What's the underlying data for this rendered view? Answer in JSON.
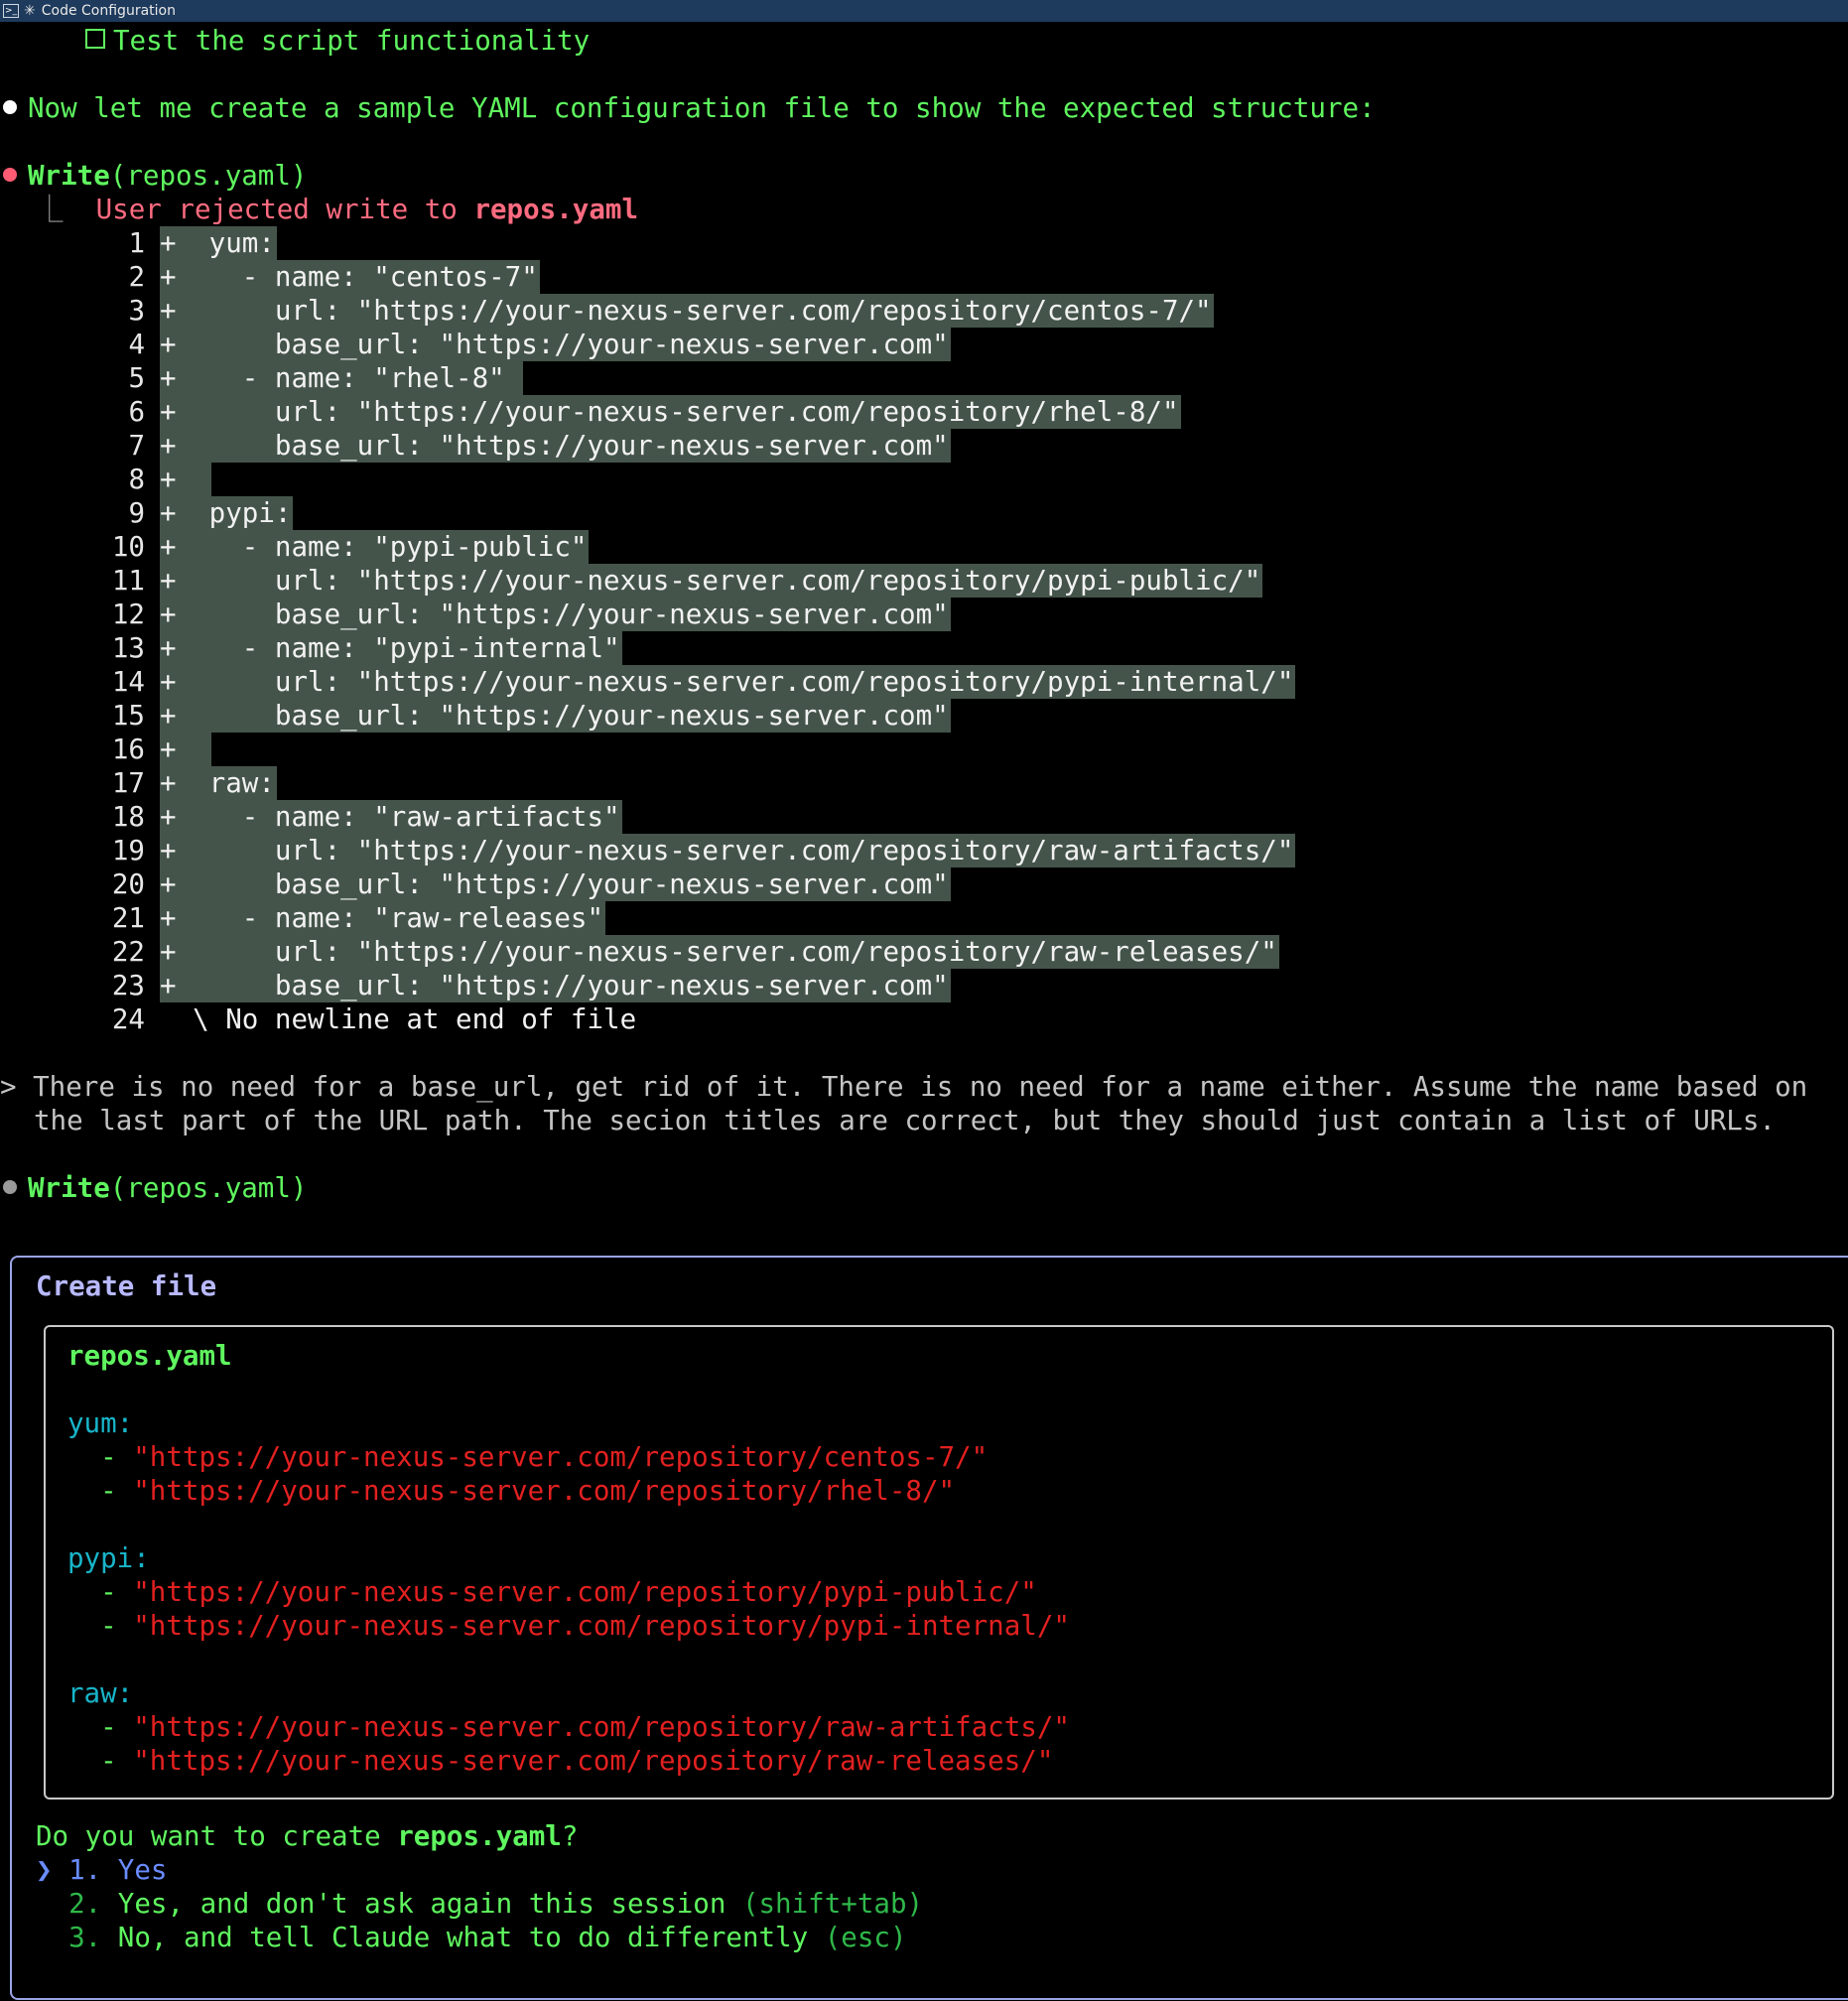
{
  "window": {
    "title": "Code Configuration"
  },
  "top_task": "Test the script functionality",
  "message1": "Now let me create a sample YAML configuration file to show the expected structure:",
  "write1": {
    "tool": "Write",
    "args": "(repos.yaml)",
    "rejected_prefix": "User rejected write to ",
    "rejected_file": "repos.yaml"
  },
  "diff": [
    {
      "n": "1",
      "t": "+  yum:"
    },
    {
      "n": "2",
      "t": "+    - name: \"centos-7\""
    },
    {
      "n": "3",
      "t": "+      url: \"https://your-nexus-server.com/repository/centos-7/\""
    },
    {
      "n": "4",
      "t": "+      base_url: \"https://your-nexus-server.com\""
    },
    {
      "n": "5",
      "t": "+    - name: \"rhel-8\" "
    },
    {
      "n": "6",
      "t": "+      url: \"https://your-nexus-server.com/repository/rhel-8/\""
    },
    {
      "n": "7",
      "t": "+      base_url: \"https://your-nexus-server.com\""
    },
    {
      "n": "8",
      "t": "+  "
    },
    {
      "n": "9",
      "t": "+  pypi:"
    },
    {
      "n": "10",
      "t": "+    - name: \"pypi-public\""
    },
    {
      "n": "11",
      "t": "+      url: \"https://your-nexus-server.com/repository/pypi-public/\""
    },
    {
      "n": "12",
      "t": "+      base_url: \"https://your-nexus-server.com\""
    },
    {
      "n": "13",
      "t": "+    - name: \"pypi-internal\""
    },
    {
      "n": "14",
      "t": "+      url: \"https://your-nexus-server.com/repository/pypi-internal/\""
    },
    {
      "n": "15",
      "t": "+      base_url: \"https://your-nexus-server.com\""
    },
    {
      "n": "16",
      "t": "+  "
    },
    {
      "n": "17",
      "t": "+  raw:"
    },
    {
      "n": "18",
      "t": "+    - name: \"raw-artifacts\""
    },
    {
      "n": "19",
      "t": "+      url: \"https://your-nexus-server.com/repository/raw-artifacts/\""
    },
    {
      "n": "20",
      "t": "+      base_url: \"https://your-nexus-server.com\""
    },
    {
      "n": "21",
      "t": "+    - name: \"raw-releases\""
    },
    {
      "n": "22",
      "t": "+      url: \"https://your-nexus-server.com/repository/raw-releases/\""
    },
    {
      "n": "23",
      "t": "+      base_url: \"https://your-nexus-server.com\""
    }
  ],
  "diff_end": {
    "n": "24",
    "t": "\\ No newline at end of file"
  },
  "user_prompt": {
    "marker": ">",
    "line1": "There is no need for a base_url, get rid of it. There is no need for a name either. Assume the name based on",
    "line2": "the last part of the URL path. The secion titles are correct, but they should just contain a list of URLs."
  },
  "write2": {
    "tool": "Write",
    "args": "(repos.yaml)"
  },
  "dialog": {
    "title": "Create file",
    "filename": "repos.yaml",
    "sections": [
      {
        "key": "yum:",
        "urls": [
          "\"https://your-nexus-server.com/repository/centos-7/\"",
          "\"https://your-nexus-server.com/repository/rhel-8/\""
        ]
      },
      {
        "key": "pypi:",
        "urls": [
          "\"https://your-nexus-server.com/repository/pypi-public/\"",
          "\"https://your-nexus-server.com/repository/pypi-internal/\""
        ]
      },
      {
        "key": "raw:",
        "urls": [
          "\"https://your-nexus-server.com/repository/raw-artifacts/\"",
          "\"https://your-nexus-server.com/repository/raw-releases/\""
        ]
      }
    ],
    "dash": "- ",
    "question_prefix": "Do you want to create ",
    "question_file": "repos.yaml",
    "question_suffix": "?",
    "options": [
      {
        "marker": "❯",
        "num": "1.",
        "label": "Yes",
        "hint": ""
      },
      {
        "marker": " ",
        "num": "2.",
        "label": "Yes, and don't ask again this session",
        "hint": "(shift+tab)"
      },
      {
        "marker": " ",
        "num": "3.",
        "label": "No, and tell Claude what to do differently",
        "hint": "(esc)"
      }
    ]
  },
  "colors": {
    "green": "#5ff55f",
    "diff_bg": "#44544a",
    "url_red": "#e32020",
    "key_cyan": "#18b5c9",
    "accent_blue": "#6a8cff"
  }
}
